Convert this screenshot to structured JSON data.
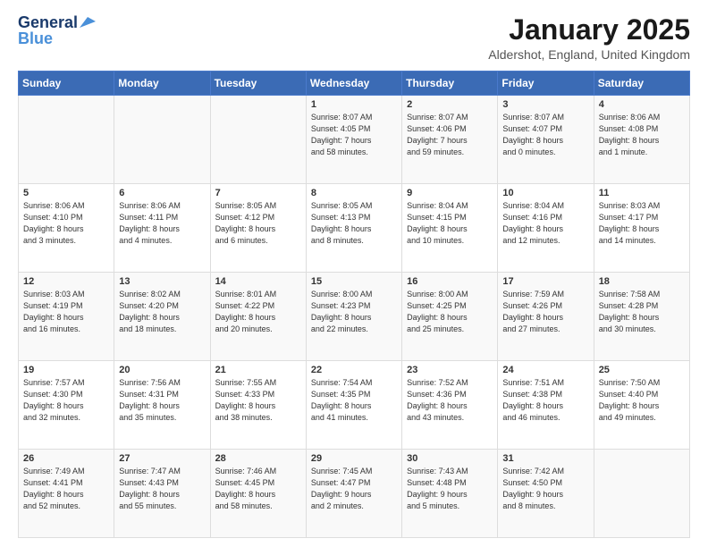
{
  "header": {
    "logo_general": "General",
    "logo_blue": "Blue",
    "title": "January 2025",
    "location": "Aldershot, England, United Kingdom"
  },
  "days_of_week": [
    "Sunday",
    "Monday",
    "Tuesday",
    "Wednesday",
    "Thursday",
    "Friday",
    "Saturday"
  ],
  "weeks": [
    [
      {
        "day": "",
        "info": ""
      },
      {
        "day": "",
        "info": ""
      },
      {
        "day": "",
        "info": ""
      },
      {
        "day": "1",
        "info": "Sunrise: 8:07 AM\nSunset: 4:05 PM\nDaylight: 7 hours\nand 58 minutes."
      },
      {
        "day": "2",
        "info": "Sunrise: 8:07 AM\nSunset: 4:06 PM\nDaylight: 7 hours\nand 59 minutes."
      },
      {
        "day": "3",
        "info": "Sunrise: 8:07 AM\nSunset: 4:07 PM\nDaylight: 8 hours\nand 0 minutes."
      },
      {
        "day": "4",
        "info": "Sunrise: 8:06 AM\nSunset: 4:08 PM\nDaylight: 8 hours\nand 1 minute."
      }
    ],
    [
      {
        "day": "5",
        "info": "Sunrise: 8:06 AM\nSunset: 4:10 PM\nDaylight: 8 hours\nand 3 minutes."
      },
      {
        "day": "6",
        "info": "Sunrise: 8:06 AM\nSunset: 4:11 PM\nDaylight: 8 hours\nand 4 minutes."
      },
      {
        "day": "7",
        "info": "Sunrise: 8:05 AM\nSunset: 4:12 PM\nDaylight: 8 hours\nand 6 minutes."
      },
      {
        "day": "8",
        "info": "Sunrise: 8:05 AM\nSunset: 4:13 PM\nDaylight: 8 hours\nand 8 minutes."
      },
      {
        "day": "9",
        "info": "Sunrise: 8:04 AM\nSunset: 4:15 PM\nDaylight: 8 hours\nand 10 minutes."
      },
      {
        "day": "10",
        "info": "Sunrise: 8:04 AM\nSunset: 4:16 PM\nDaylight: 8 hours\nand 12 minutes."
      },
      {
        "day": "11",
        "info": "Sunrise: 8:03 AM\nSunset: 4:17 PM\nDaylight: 8 hours\nand 14 minutes."
      }
    ],
    [
      {
        "day": "12",
        "info": "Sunrise: 8:03 AM\nSunset: 4:19 PM\nDaylight: 8 hours\nand 16 minutes."
      },
      {
        "day": "13",
        "info": "Sunrise: 8:02 AM\nSunset: 4:20 PM\nDaylight: 8 hours\nand 18 minutes."
      },
      {
        "day": "14",
        "info": "Sunrise: 8:01 AM\nSunset: 4:22 PM\nDaylight: 8 hours\nand 20 minutes."
      },
      {
        "day": "15",
        "info": "Sunrise: 8:00 AM\nSunset: 4:23 PM\nDaylight: 8 hours\nand 22 minutes."
      },
      {
        "day": "16",
        "info": "Sunrise: 8:00 AM\nSunset: 4:25 PM\nDaylight: 8 hours\nand 25 minutes."
      },
      {
        "day": "17",
        "info": "Sunrise: 7:59 AM\nSunset: 4:26 PM\nDaylight: 8 hours\nand 27 minutes."
      },
      {
        "day": "18",
        "info": "Sunrise: 7:58 AM\nSunset: 4:28 PM\nDaylight: 8 hours\nand 30 minutes."
      }
    ],
    [
      {
        "day": "19",
        "info": "Sunrise: 7:57 AM\nSunset: 4:30 PM\nDaylight: 8 hours\nand 32 minutes."
      },
      {
        "day": "20",
        "info": "Sunrise: 7:56 AM\nSunset: 4:31 PM\nDaylight: 8 hours\nand 35 minutes."
      },
      {
        "day": "21",
        "info": "Sunrise: 7:55 AM\nSunset: 4:33 PM\nDaylight: 8 hours\nand 38 minutes."
      },
      {
        "day": "22",
        "info": "Sunrise: 7:54 AM\nSunset: 4:35 PM\nDaylight: 8 hours\nand 41 minutes."
      },
      {
        "day": "23",
        "info": "Sunrise: 7:52 AM\nSunset: 4:36 PM\nDaylight: 8 hours\nand 43 minutes."
      },
      {
        "day": "24",
        "info": "Sunrise: 7:51 AM\nSunset: 4:38 PM\nDaylight: 8 hours\nand 46 minutes."
      },
      {
        "day": "25",
        "info": "Sunrise: 7:50 AM\nSunset: 4:40 PM\nDaylight: 8 hours\nand 49 minutes."
      }
    ],
    [
      {
        "day": "26",
        "info": "Sunrise: 7:49 AM\nSunset: 4:41 PM\nDaylight: 8 hours\nand 52 minutes."
      },
      {
        "day": "27",
        "info": "Sunrise: 7:47 AM\nSunset: 4:43 PM\nDaylight: 8 hours\nand 55 minutes."
      },
      {
        "day": "28",
        "info": "Sunrise: 7:46 AM\nSunset: 4:45 PM\nDaylight: 8 hours\nand 58 minutes."
      },
      {
        "day": "29",
        "info": "Sunrise: 7:45 AM\nSunset: 4:47 PM\nDaylight: 9 hours\nand 2 minutes."
      },
      {
        "day": "30",
        "info": "Sunrise: 7:43 AM\nSunset: 4:48 PM\nDaylight: 9 hours\nand 5 minutes."
      },
      {
        "day": "31",
        "info": "Sunrise: 7:42 AM\nSunset: 4:50 PM\nDaylight: 9 hours\nand 8 minutes."
      },
      {
        "day": "",
        "info": ""
      }
    ]
  ]
}
